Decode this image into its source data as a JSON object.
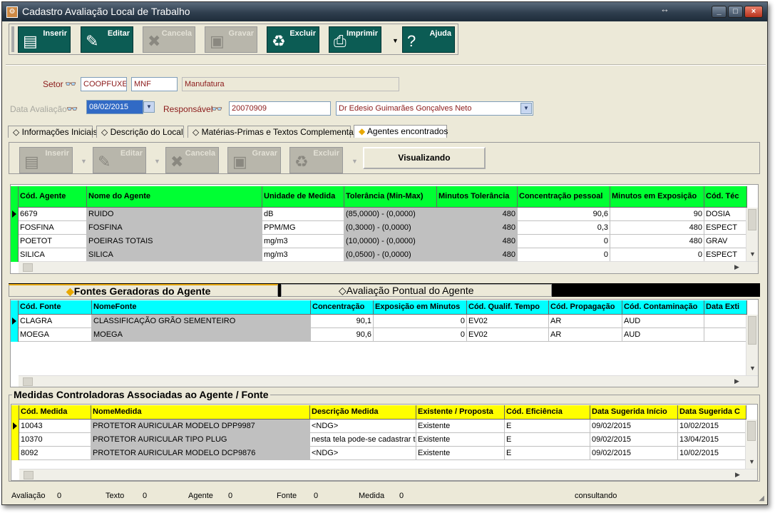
{
  "window": {
    "title": "Cadastro Avaliação Local de Trabalho",
    "controls": {
      "minimize": "_",
      "maximize": "□",
      "close": "×"
    }
  },
  "toolbar": [
    {
      "label": "Inserir",
      "icon": "insert-icon",
      "enabled": true
    },
    {
      "label": "Editar",
      "icon": "edit-icon",
      "enabled": true
    },
    {
      "label": "Cancela",
      "icon": "cancel-icon",
      "enabled": false
    },
    {
      "label": "Gravar",
      "icon": "save-icon",
      "enabled": false
    },
    {
      "label": "Excluir",
      "icon": "delete-icon",
      "enabled": true
    },
    {
      "label": "Imprimir",
      "icon": "print-icon",
      "enabled": true
    },
    {
      "label": "Ajuda",
      "icon": "help-icon",
      "enabled": true
    }
  ],
  "form": {
    "setor_label": "Setor",
    "setor_code": "COOPFUXE",
    "setor_sigla": "MNF",
    "setor_name": "Manufatura",
    "data_label": "Data Avaliação",
    "data_value": "08/02/2015",
    "responsavel_label": "Responsável",
    "responsavel_code": "20070909",
    "responsavel_name": "Dr Edesio Guimarães Gonçalves Neto"
  },
  "tabs": [
    {
      "label": "Informações Iniciais",
      "active": false
    },
    {
      "label": "Descrição do Local",
      "active": false
    },
    {
      "label": "Matérias-Primas e Textos Complementares",
      "active": false
    },
    {
      "label": "Agentes encontrados",
      "active": true
    }
  ],
  "toolbar2": {
    "buttons": [
      "Inserir",
      "Editar",
      "Cancela",
      "Gravar",
      "Excluir"
    ],
    "status_button": "Visualizando"
  },
  "agents_grid": {
    "columns": [
      "Cód. Agente",
      "Nome do Agente",
      "Unidade de Medida",
      "Tolerância (Min-Max)",
      "Minutos Tolerância",
      "Concentração pessoal",
      "Minutos em Exposição",
      "Cód. Téc"
    ],
    "rows": [
      [
        "6679",
        "RUIDO",
        "dB",
        "(85,0000) - (0,0000)",
        "480",
        "90,6",
        "90",
        "DOSIA"
      ],
      [
        "FOSFINA",
        "FOSFINA",
        "PPM/MG",
        "(0,3000) - (0,0000)",
        "480",
        "0,3",
        "480",
        "ESPECT"
      ],
      [
        "POETOT",
        "POEIRAS TOTAIS",
        "mg/m3",
        "(10,0000) - (0,0000)",
        "480",
        "0",
        "480",
        "GRAV"
      ],
      [
        "SILICA",
        "SILICA",
        "mg/m3",
        "(0,0500) - (0,0000)",
        "480",
        "0",
        "0",
        "ESPECT"
      ]
    ]
  },
  "subtabs": [
    {
      "label": "Fontes Geradoras do Agente",
      "active": true
    },
    {
      "label": "Avaliação Pontual do Agente",
      "active": false
    }
  ],
  "sources_grid": {
    "columns": [
      "Cód. Fonte",
      "NomeFonte",
      "Concentração",
      "Exposição em Minutos",
      "Cód. Qualif. Tempo",
      "Cód. Propagação",
      "Cód. Contaminação",
      "Data Exti"
    ],
    "rows": [
      [
        "CLAGRA",
        "CLASSIFICAÇÃO GRÃO SEMENTEIRO",
        "90,1",
        "0",
        "EV02",
        "AR",
        "AUD",
        ""
      ],
      [
        "MOEGA",
        "MOEGA",
        "90,6",
        "0",
        "EV02",
        "AR",
        "AUD",
        ""
      ]
    ]
  },
  "measures": {
    "group_title": "Medidas Controladoras Associadas ao Agente / Fonte",
    "columns": [
      "Cód. Medida",
      "NomeMedida",
      "Descrição Medida",
      "Existente / Proposta",
      "Cód. Eficiência",
      "Data Sugerida Início",
      "Data Sugerida C"
    ],
    "rows": [
      [
        "10043",
        "PROTETOR AURICULAR MODELO DPP9987",
        "<NDG>",
        "Existente",
        "E",
        "09/02/2015",
        "10/02/2015"
      ],
      [
        "10370",
        "PROTETOR AURICULAR TIPO PLUG",
        "nesta tela pode-se cadastrar todo",
        "Existente",
        "E",
        "09/02/2015",
        "13/04/2015"
      ],
      [
        "8092",
        "PROTETOR AURICULAR MODELO DCP9876",
        "<NDG>",
        "Existente",
        "E",
        "09/02/2015",
        "10/02/2015"
      ]
    ]
  },
  "statusbar": {
    "avaliacao_label": "Avaliação",
    "avaliacao_value": "0",
    "texto_label": "Texto",
    "texto_value": "0",
    "agente_label": "Agente",
    "agente_value": "0",
    "fonte_label": "Fonte",
    "fonte_value": "0",
    "medida_label": "Medida",
    "medida_value": "0",
    "mode": "consultando"
  },
  "colors": {
    "agents_header": "#00ff33",
    "sources_header": "#00ffff",
    "measures_header": "#ffff00",
    "toolbar_button": "#0c5c54",
    "gray_cell": "#c0c0c0",
    "accent": "#e8a800"
  }
}
